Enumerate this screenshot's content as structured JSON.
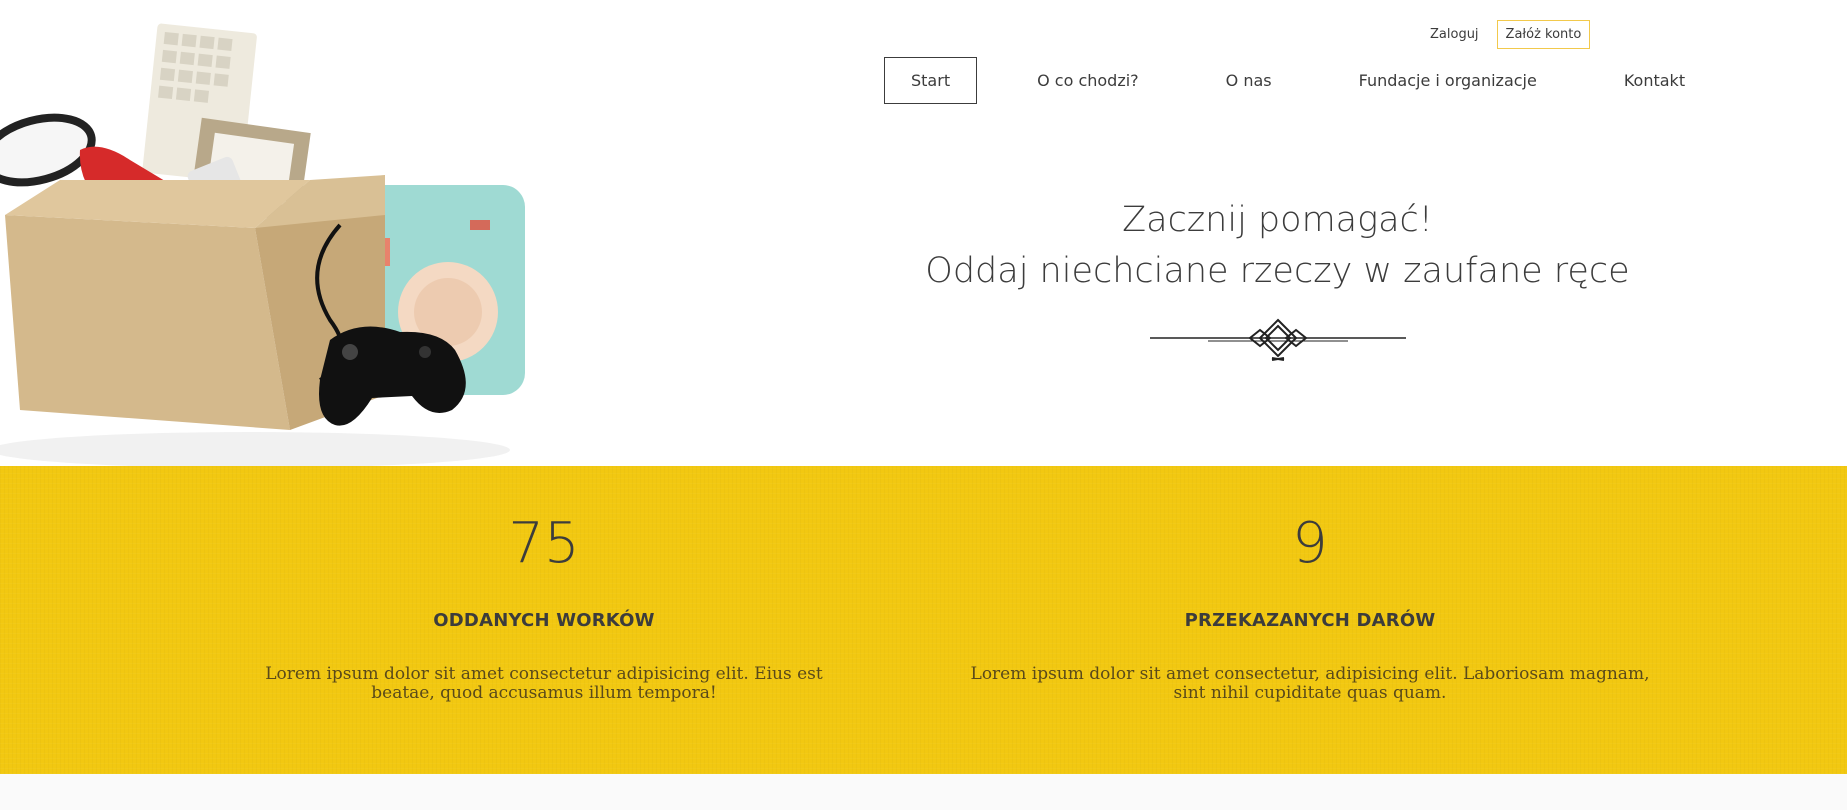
{
  "auth": {
    "login_label": "Zaloguj",
    "register_label": "Załóż konto"
  },
  "nav": {
    "items": [
      {
        "label": "Start",
        "active": true
      },
      {
        "label": "O co chodzi?",
        "active": false
      },
      {
        "label": "O nas",
        "active": false
      },
      {
        "label": "Fundacje i organizacje",
        "active": false
      },
      {
        "label": "Kontakt",
        "active": false
      }
    ]
  },
  "hero": {
    "headline_line1": "Zacznij pomagać!",
    "headline_line2": "Oddaj niechciane rzeczy w zaufane ręce",
    "image_icon": "donation-box-image",
    "ornament_icon": "decorative-ornament"
  },
  "stats": [
    {
      "value": "75",
      "label": "ODDANYCH WORKÓW",
      "description": "Lorem ipsum dolor sit amet consectetur adipisicing elit. Eius est beatae, quod accusamus illum tempora!"
    },
    {
      "value": "9",
      "label": "PRZEKAZANYCH DARÓW",
      "description": "Lorem ipsum dolor sit amet consectetur, adipisicing elit. Laboriosam magnam, sint nihil cupiditate quas quam."
    }
  ],
  "colors": {
    "accent_yellow": "#f2c811",
    "register_border": "#f2c94c",
    "text_dark": "#3c3c3c"
  }
}
